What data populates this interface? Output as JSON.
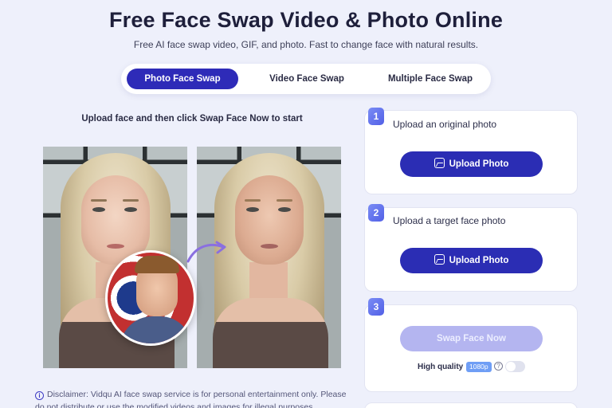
{
  "header": {
    "title": "Free Face Swap Video & Photo Online",
    "subtitle": "Free AI face swap video, GIF, and photo. Fast to change face with natural results."
  },
  "tabs": [
    {
      "label": "Photo Face Swap",
      "active": true
    },
    {
      "label": "Video Face Swap",
      "active": false
    },
    {
      "label": "Multiple Face Swap",
      "active": false
    }
  ],
  "demo": {
    "instruction": "Upload face and then click Swap Face Now to start"
  },
  "steps": [
    {
      "number": "1",
      "label": "Upload an original photo",
      "button": "Upload Photo"
    },
    {
      "number": "2",
      "label": "Upload a target face photo",
      "button": "Upload Photo"
    },
    {
      "number": "3",
      "button": "Swap Face Now"
    }
  ],
  "quality": {
    "label": "High quality",
    "badge": "1080p",
    "enabled": false
  },
  "disclaimer": "Disclaimer: Vidqu AI face swap service is for personal entertainment only. Please do not distribute or use the modified videos and images for illegal purposes.",
  "colors": {
    "accent": "#2b2db4",
    "background": "#eef0fb",
    "disabled_button": "#b4b5f0"
  }
}
